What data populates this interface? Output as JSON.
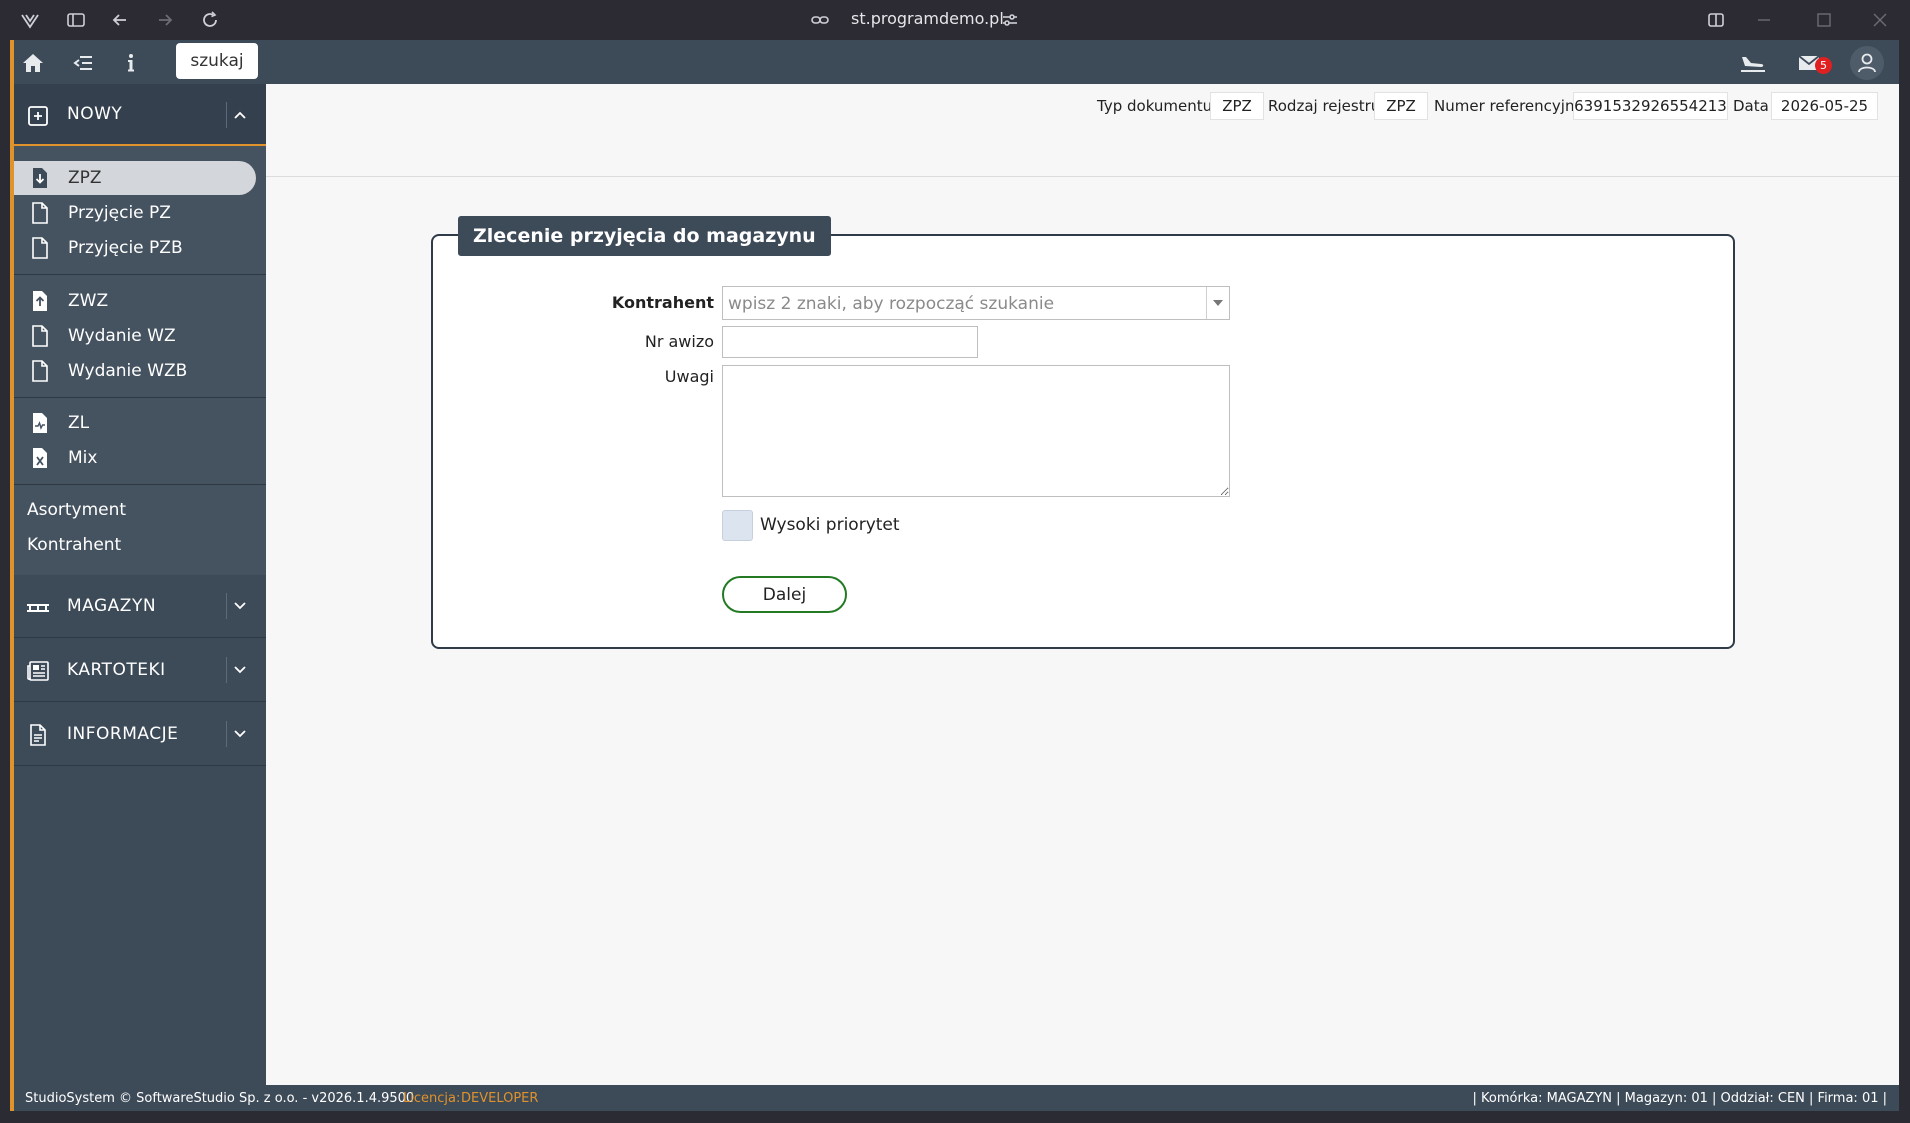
{
  "browser": {
    "url": "st.programdemo.pl"
  },
  "appbar": {
    "search_label": "szukaj",
    "mail_count": "5"
  },
  "sidebar": {
    "nowy": "NOWY",
    "items": [
      {
        "label": "ZPZ"
      },
      {
        "label": "Przyjęcie PZ"
      },
      {
        "label": "Przyjęcie PZB"
      },
      {
        "label": "ZWZ"
      },
      {
        "label": "Wydanie WZ"
      },
      {
        "label": "Wydanie WZB"
      },
      {
        "label": "ZL"
      },
      {
        "label": "Mix"
      }
    ],
    "plain": [
      {
        "label": "Asortyment"
      },
      {
        "label": "Kontrahent"
      }
    ],
    "sections": [
      {
        "label": "MAGAZYN"
      },
      {
        "label": "KARTOTEKI"
      },
      {
        "label": "INFORMACJE"
      }
    ]
  },
  "docbar": {
    "typ_label": "Typ dokumentu",
    "typ_value": "ZPZ",
    "rejestr_label": "Rodzaj rejestru",
    "rejestr_value": "ZPZ",
    "ref_label": "Numer referencyjny",
    "ref_value": "6391532926554213",
    "data_label": "Data",
    "data_value": "2026-05-25"
  },
  "form": {
    "title": "Zlecenie przyjęcia do magazynu",
    "kontrahent_label": "Kontrahent",
    "kontrahent_placeholder": "wpisz 2 znaki, aby rozpocząć szukanie",
    "awizo_label": "Nr awizo",
    "uwagi_label": "Uwagi",
    "priorytet_label": "Wysoki priorytet",
    "dalej_label": "Dalej"
  },
  "status": {
    "copyright": "StudioSystem © SoftwareStudio Sp. z o.o. - v2026.1.4.9500",
    "licencja_label": "Licencja:",
    "licencja_value": "DEVELOPER",
    "right": "| Komórka: MAGAZYN | Magazyn: 01 | Oddział: CEN | Firma: 01 |"
  },
  "colors": {
    "accent": "#e0922b",
    "sidebar": "#3d4a58",
    "button_border": "#237a23"
  }
}
